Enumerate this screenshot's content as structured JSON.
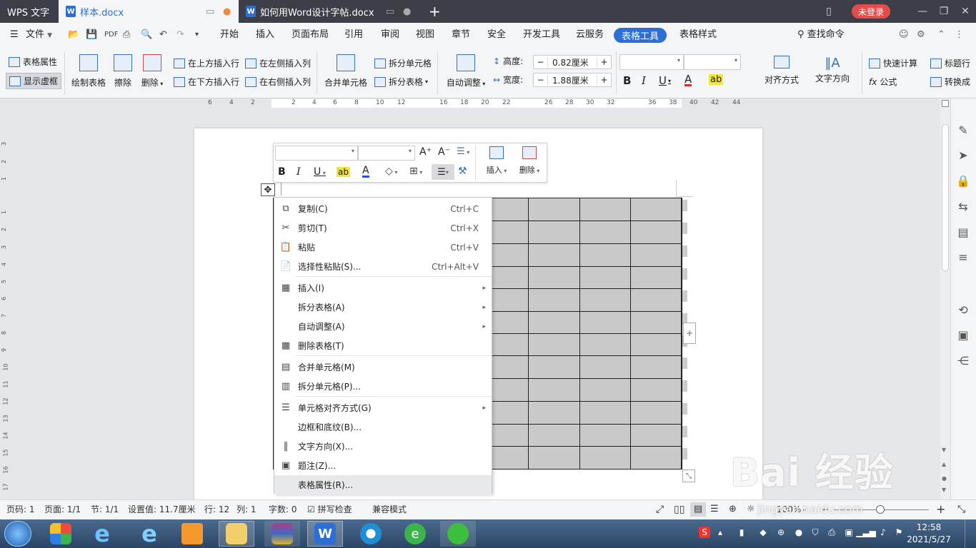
{
  "titlebar": {
    "app": "WPS 文字",
    "tab1": "样本.docx",
    "tab2": "如何用Word设计字帖.docx",
    "new_tab": "+",
    "login": "未登录"
  },
  "menubar": {
    "file": "文件",
    "items": [
      "开始",
      "插入",
      "页面布局",
      "引用",
      "审阅",
      "视图",
      "章节",
      "安全",
      "开发工具",
      "云服务",
      "表格工具",
      "表格样式"
    ],
    "search": "查找命令"
  },
  "ribbon": {
    "table_props": "表格属性",
    "show_gridlines": "显示虚框",
    "draw_table": "绘制表格",
    "erase": "擦除",
    "delete": "删除",
    "insert_above": "在上方插入行",
    "insert_below": "在下方插入行",
    "insert_left": "在左侧插入列",
    "insert_right": "在右侧插入列",
    "merge_cells": "合并单元格",
    "split_cells": "拆分单元格",
    "split_table": "拆分表格",
    "auto_fit": "自动调整",
    "height_label": "高度:",
    "height_value": "0.82厘米",
    "width_label": "宽度:",
    "width_value": "1.88厘米",
    "bold": "B",
    "italic": "I",
    "underline": "U",
    "font_color": "A",
    "align": "对齐方式",
    "text_dir": "文字方向",
    "quick_calc": "快速计算",
    "formula": "公式",
    "caption": "标题行",
    "convert": "转换成"
  },
  "ruler": {
    "ticks": [
      "6",
      "4",
      "2",
      "2",
      "4",
      "6",
      "8",
      "10",
      "12",
      "16",
      "18",
      "20",
      "22",
      "26",
      "28",
      "30",
      "32",
      "36",
      "38",
      "40",
      "42",
      "44"
    ]
  },
  "vruler": {
    "ticks": [
      "3",
      "2",
      "1",
      "1",
      "2",
      "3",
      "4",
      "5",
      "6",
      "7",
      "8",
      "9",
      "10",
      "11",
      "12",
      "13",
      "14",
      "15",
      "16",
      "17"
    ]
  },
  "minitoolbar": {
    "grow": "A⁺",
    "shrink": "A⁻",
    "bold": "B",
    "italic": "I",
    "underline": "U",
    "font_color": "A",
    "insert": "插入",
    "delete": "删除"
  },
  "context_menu": [
    {
      "label": "复制(C)",
      "shortcut": "Ctrl+C",
      "icon": "copy-icon",
      "sym": "⧉"
    },
    {
      "label": "剪切(T)",
      "shortcut": "Ctrl+X",
      "icon": "scissors-icon",
      "sym": "✂"
    },
    {
      "label": "粘贴",
      "shortcut": "Ctrl+V",
      "icon": "paste-icon",
      "sym": "📋"
    },
    {
      "label": "选择性粘贴(S)...",
      "shortcut": "Ctrl+Alt+V",
      "icon": "paste-special-icon",
      "sym": "📄"
    },
    {
      "label": "插入(I)",
      "submenu": true,
      "icon": "insert-table-icon",
      "sym": "▦"
    },
    {
      "label": "拆分表格(A)",
      "submenu": true
    },
    {
      "label": "自动调整(A)",
      "submenu": true
    },
    {
      "label": "删除表格(T)",
      "icon": "delete-table-icon",
      "sym": "▦"
    },
    {
      "label": "合并单元格(M)",
      "icon": "merge-cells-icon",
      "sym": "▤"
    },
    {
      "label": "拆分单元格(P)...",
      "icon": "split-cells-icon",
      "sym": "▥"
    },
    {
      "label": "单元格对齐方式(G)",
      "submenu": true,
      "icon": "cell-align-icon",
      "sym": "☰"
    },
    {
      "label": "边框和底纹(B)..."
    },
    {
      "label": "文字方向(X)...",
      "icon": "text-direction-icon",
      "sym": "‖"
    },
    {
      "label": "题注(Z)...",
      "icon": "caption-icon",
      "sym": "▣"
    },
    {
      "label": "表格属性(R)..."
    }
  ],
  "statusbar": {
    "page_no": "页码: 1",
    "page": "页面: 1/1",
    "section": "节: 1/1",
    "setting": "设置值: 11.7厘米",
    "row": "行: 12",
    "col": "列: 1",
    "words": "字数: 0",
    "spell": "拼写检查",
    "compat": "兼容模式",
    "zoom": "100%"
  },
  "watermark": {
    "brand": "Bai 经验",
    "url": "jingyan.baidu.com"
  },
  "clock": {
    "time": "12:58",
    "date": "2021/5/27"
  },
  "colors": {
    "accent": "#2b6fd6",
    "cell_fill": "#c9c9c9",
    "login": "#e64b4b"
  }
}
